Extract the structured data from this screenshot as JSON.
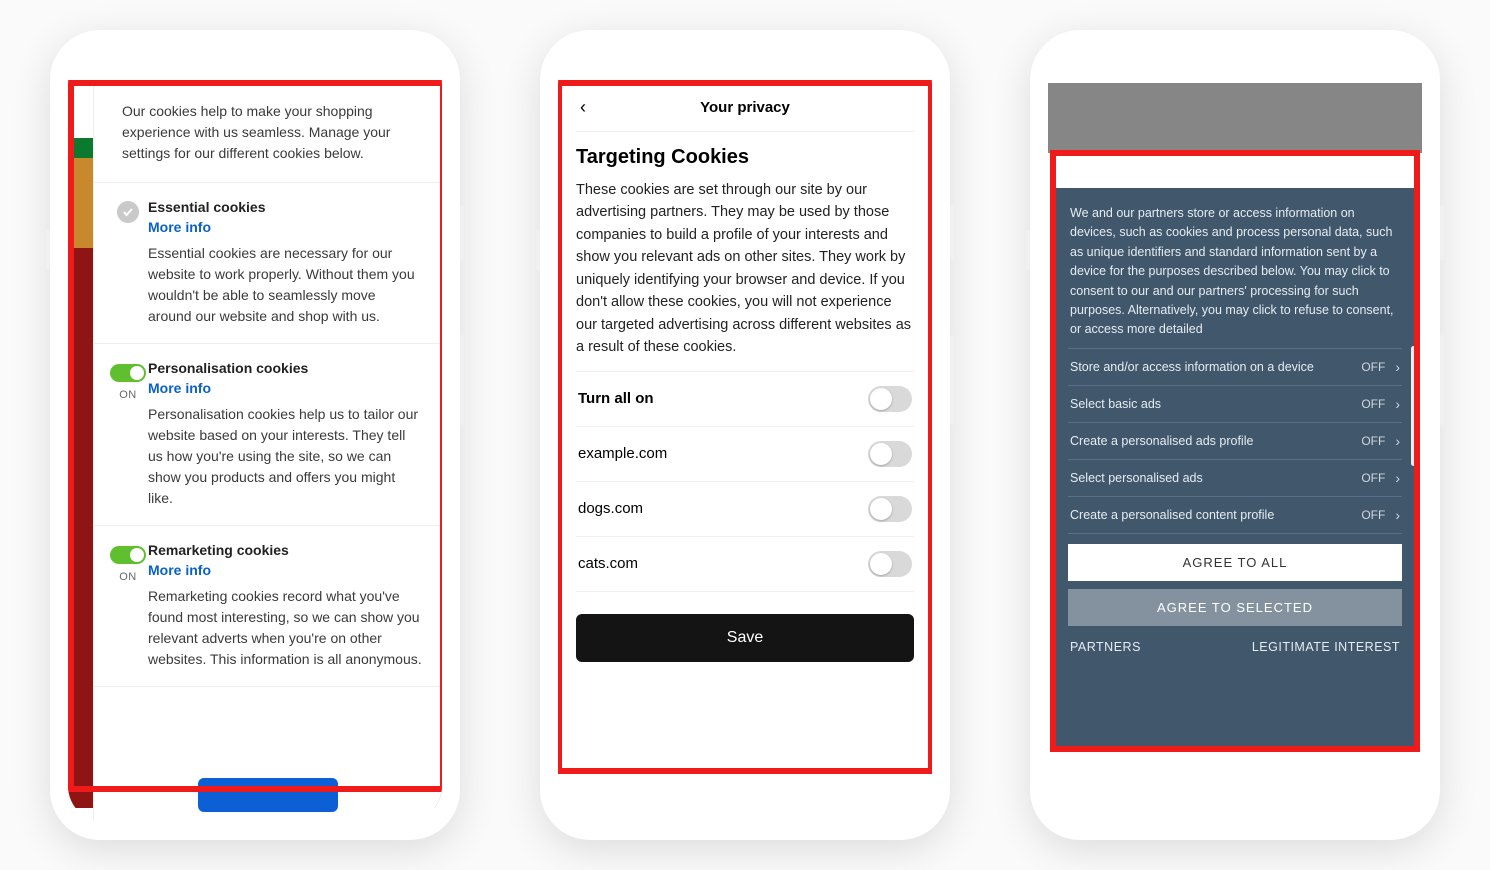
{
  "phone1": {
    "intro": "Our cookies help to make your shopping experience with us seamless. Manage your settings for our different cookies below.",
    "items": [
      {
        "title": "Essential cookies",
        "more_label": "More info",
        "desc": "Essential cookies are necessary for our website to work properly. Without them you wouldn't be able to seamlessly move around our website and shop with us.",
        "control": "check"
      },
      {
        "title": "Personalisation cookies",
        "more_label": "More info",
        "desc": "Personalisation cookies help us to tailor our website based on your interests. They tell us how you're using the site, so we can show you products and offers you might like.",
        "control": "toggle",
        "state_label": "ON"
      },
      {
        "title": "Remarketing cookies",
        "more_label": "More info",
        "desc": "Remarketing cookies record what you've found most interesting, so we can show you relevant adverts when you're on other websites. This information is all anonymous.",
        "control": "toggle",
        "state_label": "ON"
      }
    ]
  },
  "phone2": {
    "header_title": "Your privacy",
    "heading": "Targeting Cookies",
    "desc": "These cookies are set through our site by our advertising partners. They may be used by those companies to build a profile of your interests and show you relevant ads on other sites. They work by uniquely identifying your browser and device. If you don't allow these cookies, you will not experience our targeted advertising across different websites as a result of these cookies.",
    "turn_all_label": "Turn all on",
    "rows": [
      {
        "label": "example.com"
      },
      {
        "label": "dogs.com"
      },
      {
        "label": "cats.com"
      }
    ],
    "save_label": "Save"
  },
  "phone3": {
    "intro": "We and our partners store or access information on devices, such as cookies and process personal data, such as unique identifiers and standard information sent by a device for the purposes described below. You may click to consent to our and our partners' processing for such purposes. Alternatively, you may click to refuse to consent, or access more detailed",
    "off_label": "OFF",
    "items": [
      {
        "label": "Store and/or access information on a device"
      },
      {
        "label": "Select basic ads"
      },
      {
        "label": "Create a personalised ads profile"
      },
      {
        "label": "Select personalised ads"
      },
      {
        "label": "Create a personalised content profile"
      }
    ],
    "agree_all": "AGREE TO ALL",
    "agree_selected": "AGREE TO SELECTED",
    "partners": "PARTNERS",
    "legit": "LEGITIMATE INTEREST"
  }
}
